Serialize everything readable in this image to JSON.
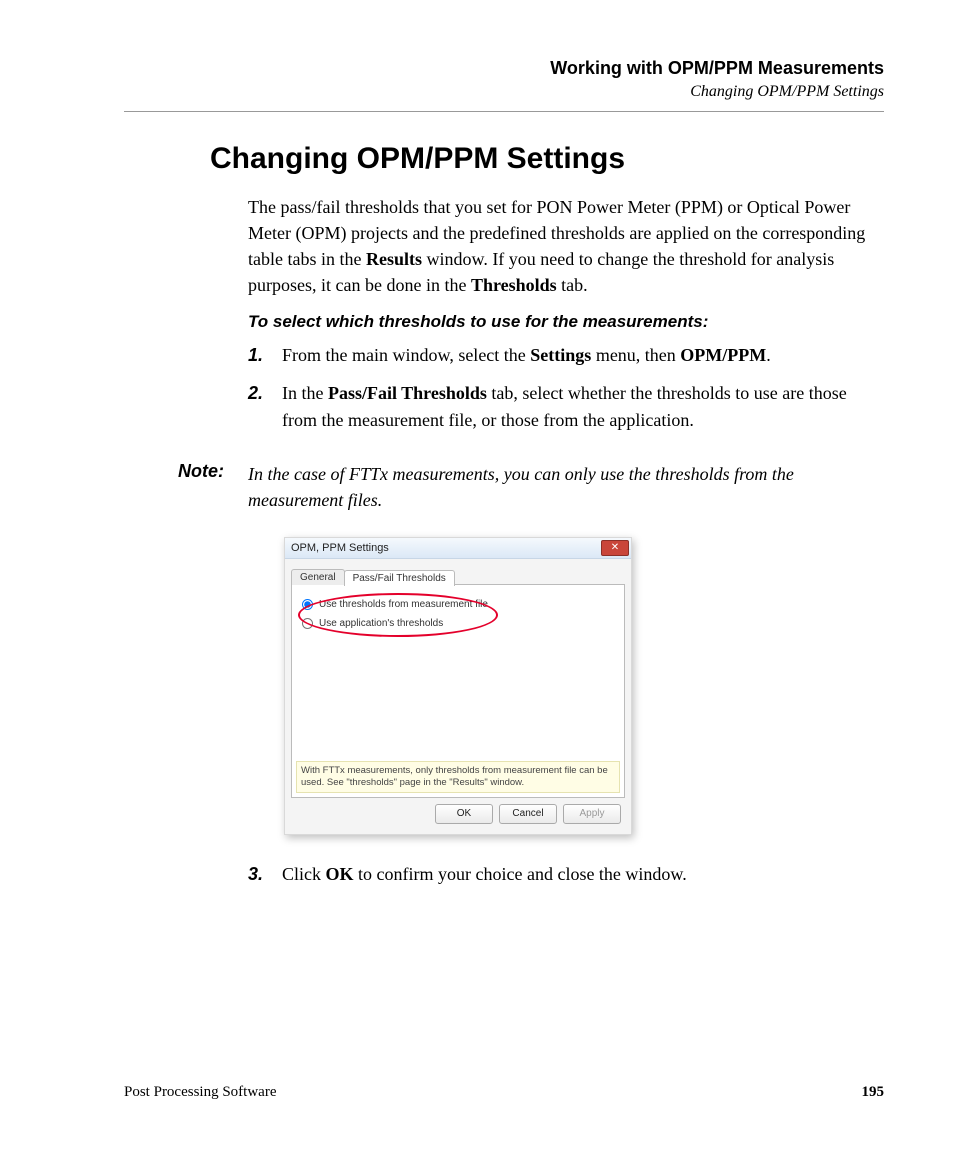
{
  "header": {
    "title": "Working with OPM/PPM Measurements",
    "subtitle": "Changing OPM/PPM Settings"
  },
  "section_title": "Changing OPM/PPM Settings",
  "intro": {
    "t1": "The pass/fail thresholds that you set for PON Power Meter (PPM) or Optical Power Meter (OPM) projects and the predefined thresholds are applied on the corresponding table tabs in the ",
    "b1": "Results",
    "t2": " window. If you need to change the threshold for analysis purposes, it can be done in the ",
    "b2": "Thresholds",
    "t3": " tab."
  },
  "lead": "To select which thresholds to use for the measurements:",
  "steps": [
    {
      "num": "1.",
      "t1": "From the main window, select the ",
      "b1": "Settings",
      "t2": " menu, then ",
      "b2": "OPM/PPM",
      "t3": "."
    },
    {
      "num": "2.",
      "t1": "In the ",
      "b1": "Pass/Fail Thresholds",
      "t2": " tab, select whether the thresholds to use are those from the measurement file, or those from the application.",
      "b2": "",
      "t3": ""
    }
  ],
  "note": {
    "label": "Note:",
    "text": "In the case of FTTx measurements, you can only use the thresholds from the measurement files."
  },
  "dialog": {
    "title": "OPM, PPM Settings",
    "tabs": {
      "general": "General",
      "thresholds": "Pass/Fail Thresholds"
    },
    "radio1": "Use thresholds from measurement file",
    "radio2": "Use application's thresholds",
    "hint": "With FTTx measurements, only thresholds from measurement file can be used.  See \"thresholds\" page in the \"Results\" window.",
    "buttons": {
      "ok": "OK",
      "cancel": "Cancel",
      "apply": "Apply"
    }
  },
  "step3": {
    "num": "3.",
    "t1": "Click ",
    "b1": "OK",
    "t2": " to confirm your choice and close the window."
  },
  "footer": {
    "product": "Post Processing Software",
    "page": "195"
  }
}
